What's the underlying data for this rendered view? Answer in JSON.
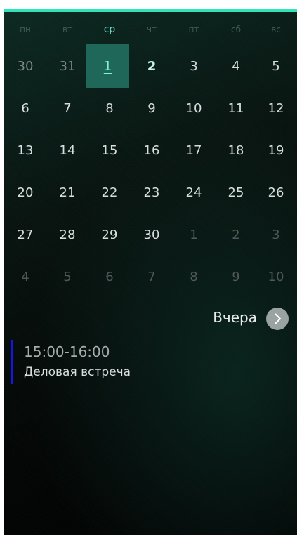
{
  "weekdays": [
    "пн",
    "вт",
    "ср",
    "чт",
    "пт",
    "сб",
    "вс"
  ],
  "calendar": {
    "rows": [
      [
        {
          "label": "30",
          "state": "muted"
        },
        {
          "label": "31",
          "state": "muted"
        },
        {
          "label": "1",
          "state": "selected"
        },
        {
          "label": "2",
          "state": "today"
        },
        {
          "label": "3",
          "state": "normal"
        },
        {
          "label": "4",
          "state": "normal"
        },
        {
          "label": "5",
          "state": "normal"
        }
      ],
      [
        {
          "label": "6",
          "state": "normal"
        },
        {
          "label": "7",
          "state": "normal"
        },
        {
          "label": "8",
          "state": "normal"
        },
        {
          "label": "9",
          "state": "normal"
        },
        {
          "label": "10",
          "state": "normal"
        },
        {
          "label": "11",
          "state": "normal"
        },
        {
          "label": "12",
          "state": "normal"
        }
      ],
      [
        {
          "label": "13",
          "state": "normal"
        },
        {
          "label": "14",
          "state": "normal"
        },
        {
          "label": "15",
          "state": "normal"
        },
        {
          "label": "16",
          "state": "normal"
        },
        {
          "label": "17",
          "state": "normal"
        },
        {
          "label": "18",
          "state": "normal"
        },
        {
          "label": "19",
          "state": "normal"
        }
      ],
      [
        {
          "label": "20",
          "state": "normal"
        },
        {
          "label": "21",
          "state": "normal"
        },
        {
          "label": "22",
          "state": "normal"
        },
        {
          "label": "23",
          "state": "normal"
        },
        {
          "label": "24",
          "state": "normal"
        },
        {
          "label": "25",
          "state": "normal"
        },
        {
          "label": "26",
          "state": "normal"
        }
      ],
      [
        {
          "label": "27",
          "state": "normal"
        },
        {
          "label": "28",
          "state": "normal"
        },
        {
          "label": "29",
          "state": "normal"
        },
        {
          "label": "30",
          "state": "normal"
        },
        {
          "label": "1",
          "state": "faint"
        },
        {
          "label": "2",
          "state": "faint"
        },
        {
          "label": "3",
          "state": "faint"
        }
      ],
      [
        {
          "label": "4",
          "state": "faint"
        },
        {
          "label": "5",
          "state": "faint"
        },
        {
          "label": "6",
          "state": "faint"
        },
        {
          "label": "7",
          "state": "faint"
        },
        {
          "label": "8",
          "state": "faint"
        },
        {
          "label": "9",
          "state": "faint"
        },
        {
          "label": "10",
          "state": "faint"
        }
      ]
    ]
  },
  "navigation": {
    "label": "Вчера",
    "icon": "chevron-right-icon"
  },
  "events": [
    {
      "time": "15:00-16:00",
      "title": "Деловая встреча",
      "color": "#1616e8"
    }
  ],
  "colors": {
    "accent": "#2ee6b8",
    "selected_day": "#1f6758"
  }
}
